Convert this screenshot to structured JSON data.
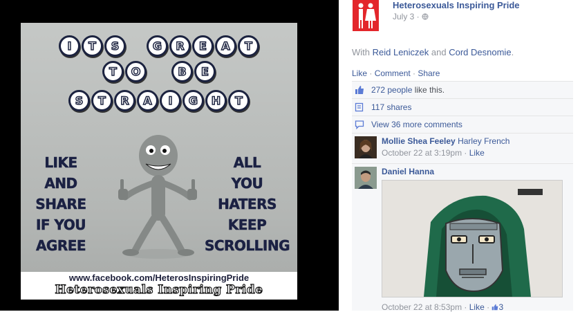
{
  "meme": {
    "title_line1": [
      "I",
      "T",
      "S",
      "G",
      "R",
      "E",
      "A",
      "T"
    ],
    "title_line2": [
      "T",
      "O",
      "B",
      "E"
    ],
    "title_line3": [
      "S",
      "T",
      "R",
      "A",
      "I",
      "G",
      "H",
      "T"
    ],
    "left_words": [
      "LIKE",
      "AND",
      "SHARE",
      "IF YOU",
      "AGREE"
    ],
    "right_words": [
      "ALL",
      "YOU",
      "HATERS",
      "KEEP",
      "SCROLLING"
    ],
    "url": "www.facebook.com/HeterosInspiringPride",
    "brand": "Heterosexuals Inspiring Pride"
  },
  "post": {
    "page_name": "Heterosexuals Inspiring Pride",
    "date": "July 3 ·",
    "with_prefix": "With",
    "tagged_1": "Reid Leniczek",
    "and": "and",
    "tagged_2": "Cord Desnomie",
    "period": ".",
    "actions": {
      "like": "Like",
      "comment": "Comment",
      "share": "Share",
      "sep": " · "
    },
    "likes_count": "272 people",
    "likes_suffix": " like this.",
    "shares": "117 shares",
    "more_comments": "View 36 more comments"
  },
  "comments": [
    {
      "author": "Mollie Shea Feeley",
      "text": "Harley French",
      "time": "October 22 at 3:19pm",
      "sep": " · ",
      "like": "Like"
    },
    {
      "author": "Daniel Hanna",
      "time": "October 22 at 8:53pm",
      "sep": " · ",
      "like": "Like",
      "sep2": " · ",
      "reactions": "3"
    }
  ],
  "colors": {
    "link": "#3b5998",
    "meta": "#90949c",
    "accent_red": "#e3262b",
    "panel": "#f6f7f9"
  },
  "icons": [
    "page-avatar-icon",
    "globe-icon",
    "thumbs-up-icon",
    "share-icon",
    "comment-icon"
  ]
}
